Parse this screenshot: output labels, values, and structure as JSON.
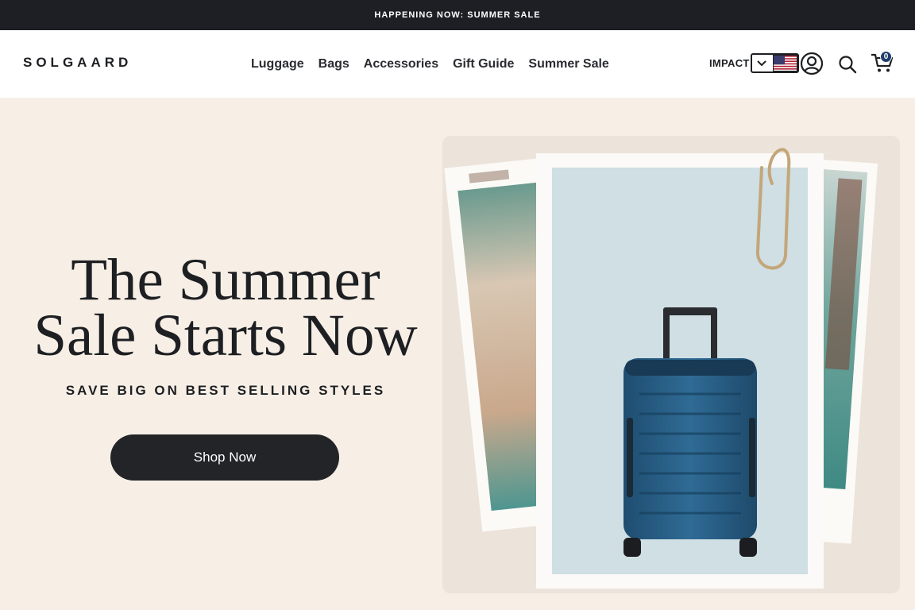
{
  "announcement": {
    "text": "HAPPENING NOW: SUMMER SALE"
  },
  "header": {
    "logo": "SOLGAARD",
    "nav": [
      "Luggage",
      "Bags",
      "Accessories",
      "Gift Guide",
      "Summer Sale"
    ],
    "impact_label": "IMPACT",
    "cart_count": "0"
  },
  "hero": {
    "title_line1": "The Summer",
    "title_line2": "Sale Starts Now",
    "subtitle": "SAVE BIG ON BEST SELLING STYLES",
    "cta_label": "Shop Now"
  },
  "icons": {
    "locale_chevron": "chevron-down-icon",
    "flag": "us-flag-icon",
    "account": "account-icon",
    "search": "search-icon",
    "cart": "cart-icon"
  },
  "colors": {
    "announcement_bg": "#1d1f25",
    "hero_bg": "#f7efe6",
    "cta_bg": "#222427",
    "suitcase": "#2b5f86",
    "badge": "#1e3d6b"
  }
}
